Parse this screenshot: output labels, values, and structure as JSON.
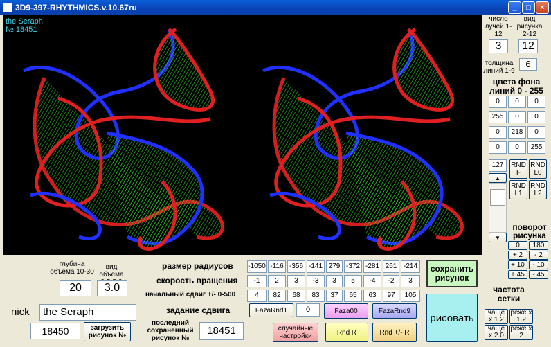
{
  "window": {
    "title": "3D9-397-RHYTHMICS.v.10.67ru"
  },
  "canvas": {
    "author": "the Seraph",
    "number": "№ 18451"
  },
  "right": {
    "rays_label": "число лучей 1-12",
    "rays_value": "3",
    "kind_label": "вид рисунка 2-12",
    "kind_value": "12",
    "thick_label": "толщина линий 1-9",
    "thick_value": "6",
    "colors_title": "цвета фона линий 0 - 255",
    "colors": [
      [
        "0",
        "0",
        "0"
      ],
      [
        "255",
        "0",
        "0"
      ],
      [
        "0",
        "218",
        "0"
      ],
      [
        "0",
        "0",
        "255"
      ]
    ],
    "scroll_value": "127",
    "rnd": [
      "RND F",
      "RND L0",
      "RND L1",
      "RND L2"
    ],
    "rotation_title": "поворот рисунка",
    "rotation": [
      "0",
      "180",
      "+ 2",
      "- 2",
      "+ 10",
      "- 10",
      "+ 45",
      "- 45"
    ],
    "freq_title": "частота сетки",
    "freq": [
      "чаще x 1.2",
      "реже x 1.2",
      "чаще x 2.0",
      "реже x 2"
    ]
  },
  "bottom": {
    "depth_label": "глубина объема 10-30",
    "depth_value": "20",
    "vol_label": "вид объема 0.5-5.0",
    "vol_value": "3.0",
    "nick_label": "nick",
    "nick_value": "the Seraph",
    "load_value": "18450",
    "load_btn": "загрузить рисунок №",
    "radii_label": "размер радиусов",
    "radii": [
      "-1050",
      "-116",
      "-356",
      "-141",
      "279",
      "-372",
      "-281",
      "261",
      "-214"
    ],
    "speed_label": "скорость вращения",
    "speed": [
      "-1",
      "2",
      "3",
      "-3",
      "3",
      "5",
      "-4",
      "-2",
      "3"
    ],
    "shift_label": "начальный сдвиг +/- 0-500",
    "shift": [
      "4",
      "82",
      "68",
      "83",
      "37",
      "65",
      "63",
      "97",
      "105"
    ],
    "shift_set_label": "задание сдвига",
    "faza_rnd1": "FazaRnd1",
    "faza_value": "0",
    "faza00": "Faza00",
    "faza_rnd9": "FazaRnd9",
    "last_label": "последний сохраненный рисунок №",
    "last_value": "18451",
    "random_btn": "случайные настройки",
    "rnd_r": "Rnd R",
    "rnd_pm_r": "Rnd +/- R",
    "save_btn": "сохранить рисунок",
    "draw_btn": "рисовать"
  }
}
